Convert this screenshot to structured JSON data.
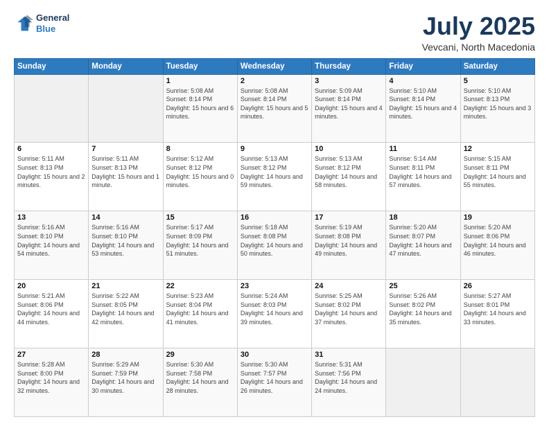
{
  "header": {
    "logo_line1": "General",
    "logo_line2": "Blue",
    "title": "July 2025",
    "subtitle": "Vevcani, North Macedonia"
  },
  "days_of_week": [
    "Sunday",
    "Monday",
    "Tuesday",
    "Wednesday",
    "Thursday",
    "Friday",
    "Saturday"
  ],
  "weeks": [
    [
      {
        "num": "",
        "sunrise": "",
        "sunset": "",
        "daylight": "",
        "empty": true
      },
      {
        "num": "",
        "sunrise": "",
        "sunset": "",
        "daylight": "",
        "empty": true
      },
      {
        "num": "1",
        "sunrise": "Sunrise: 5:08 AM",
        "sunset": "Sunset: 8:14 PM",
        "daylight": "Daylight: 15 hours and 6 minutes."
      },
      {
        "num": "2",
        "sunrise": "Sunrise: 5:08 AM",
        "sunset": "Sunset: 8:14 PM",
        "daylight": "Daylight: 15 hours and 5 minutes."
      },
      {
        "num": "3",
        "sunrise": "Sunrise: 5:09 AM",
        "sunset": "Sunset: 8:14 PM",
        "daylight": "Daylight: 15 hours and 4 minutes."
      },
      {
        "num": "4",
        "sunrise": "Sunrise: 5:10 AM",
        "sunset": "Sunset: 8:14 PM",
        "daylight": "Daylight: 15 hours and 4 minutes."
      },
      {
        "num": "5",
        "sunrise": "Sunrise: 5:10 AM",
        "sunset": "Sunset: 8:13 PM",
        "daylight": "Daylight: 15 hours and 3 minutes."
      }
    ],
    [
      {
        "num": "6",
        "sunrise": "Sunrise: 5:11 AM",
        "sunset": "Sunset: 8:13 PM",
        "daylight": "Daylight: 15 hours and 2 minutes."
      },
      {
        "num": "7",
        "sunrise": "Sunrise: 5:11 AM",
        "sunset": "Sunset: 8:13 PM",
        "daylight": "Daylight: 15 hours and 1 minute."
      },
      {
        "num": "8",
        "sunrise": "Sunrise: 5:12 AM",
        "sunset": "Sunset: 8:12 PM",
        "daylight": "Daylight: 15 hours and 0 minutes."
      },
      {
        "num": "9",
        "sunrise": "Sunrise: 5:13 AM",
        "sunset": "Sunset: 8:12 PM",
        "daylight": "Daylight: 14 hours and 59 minutes."
      },
      {
        "num": "10",
        "sunrise": "Sunrise: 5:13 AM",
        "sunset": "Sunset: 8:12 PM",
        "daylight": "Daylight: 14 hours and 58 minutes."
      },
      {
        "num": "11",
        "sunrise": "Sunrise: 5:14 AM",
        "sunset": "Sunset: 8:11 PM",
        "daylight": "Daylight: 14 hours and 57 minutes."
      },
      {
        "num": "12",
        "sunrise": "Sunrise: 5:15 AM",
        "sunset": "Sunset: 8:11 PM",
        "daylight": "Daylight: 14 hours and 55 minutes."
      }
    ],
    [
      {
        "num": "13",
        "sunrise": "Sunrise: 5:16 AM",
        "sunset": "Sunset: 8:10 PM",
        "daylight": "Daylight: 14 hours and 54 minutes."
      },
      {
        "num": "14",
        "sunrise": "Sunrise: 5:16 AM",
        "sunset": "Sunset: 8:10 PM",
        "daylight": "Daylight: 14 hours and 53 minutes."
      },
      {
        "num": "15",
        "sunrise": "Sunrise: 5:17 AM",
        "sunset": "Sunset: 8:09 PM",
        "daylight": "Daylight: 14 hours and 51 minutes."
      },
      {
        "num": "16",
        "sunrise": "Sunrise: 5:18 AM",
        "sunset": "Sunset: 8:08 PM",
        "daylight": "Daylight: 14 hours and 50 minutes."
      },
      {
        "num": "17",
        "sunrise": "Sunrise: 5:19 AM",
        "sunset": "Sunset: 8:08 PM",
        "daylight": "Daylight: 14 hours and 49 minutes."
      },
      {
        "num": "18",
        "sunrise": "Sunrise: 5:20 AM",
        "sunset": "Sunset: 8:07 PM",
        "daylight": "Daylight: 14 hours and 47 minutes."
      },
      {
        "num": "19",
        "sunrise": "Sunrise: 5:20 AM",
        "sunset": "Sunset: 8:06 PM",
        "daylight": "Daylight: 14 hours and 46 minutes."
      }
    ],
    [
      {
        "num": "20",
        "sunrise": "Sunrise: 5:21 AM",
        "sunset": "Sunset: 8:06 PM",
        "daylight": "Daylight: 14 hours and 44 minutes."
      },
      {
        "num": "21",
        "sunrise": "Sunrise: 5:22 AM",
        "sunset": "Sunset: 8:05 PM",
        "daylight": "Daylight: 14 hours and 42 minutes."
      },
      {
        "num": "22",
        "sunrise": "Sunrise: 5:23 AM",
        "sunset": "Sunset: 8:04 PM",
        "daylight": "Daylight: 14 hours and 41 minutes."
      },
      {
        "num": "23",
        "sunrise": "Sunrise: 5:24 AM",
        "sunset": "Sunset: 8:03 PM",
        "daylight": "Daylight: 14 hours and 39 minutes."
      },
      {
        "num": "24",
        "sunrise": "Sunrise: 5:25 AM",
        "sunset": "Sunset: 8:02 PM",
        "daylight": "Daylight: 14 hours and 37 minutes."
      },
      {
        "num": "25",
        "sunrise": "Sunrise: 5:26 AM",
        "sunset": "Sunset: 8:02 PM",
        "daylight": "Daylight: 14 hours and 35 minutes."
      },
      {
        "num": "26",
        "sunrise": "Sunrise: 5:27 AM",
        "sunset": "Sunset: 8:01 PM",
        "daylight": "Daylight: 14 hours and 33 minutes."
      }
    ],
    [
      {
        "num": "27",
        "sunrise": "Sunrise: 5:28 AM",
        "sunset": "Sunset: 8:00 PM",
        "daylight": "Daylight: 14 hours and 32 minutes."
      },
      {
        "num": "28",
        "sunrise": "Sunrise: 5:29 AM",
        "sunset": "Sunset: 7:59 PM",
        "daylight": "Daylight: 14 hours and 30 minutes."
      },
      {
        "num": "29",
        "sunrise": "Sunrise: 5:30 AM",
        "sunset": "Sunset: 7:58 PM",
        "daylight": "Daylight: 14 hours and 28 minutes."
      },
      {
        "num": "30",
        "sunrise": "Sunrise: 5:30 AM",
        "sunset": "Sunset: 7:57 PM",
        "daylight": "Daylight: 14 hours and 26 minutes."
      },
      {
        "num": "31",
        "sunrise": "Sunrise: 5:31 AM",
        "sunset": "Sunset: 7:56 PM",
        "daylight": "Daylight: 14 hours and 24 minutes."
      },
      {
        "num": "",
        "sunrise": "",
        "sunset": "",
        "daylight": "",
        "empty": true
      },
      {
        "num": "",
        "sunrise": "",
        "sunset": "",
        "daylight": "",
        "empty": true
      }
    ]
  ]
}
